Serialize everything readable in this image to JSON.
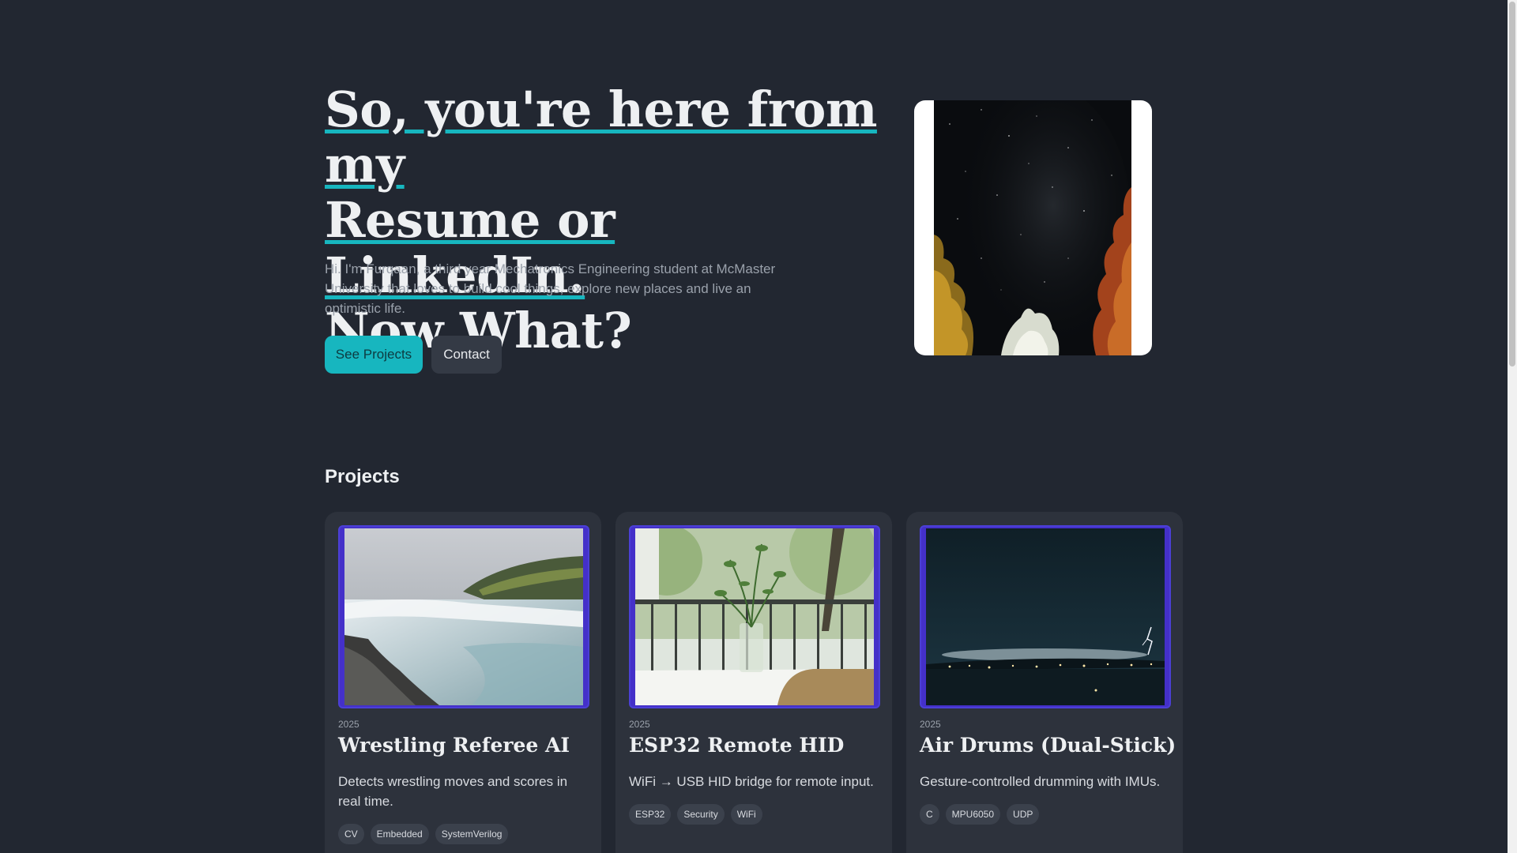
{
  "hero": {
    "heading_line1": "So, you're here from my",
    "heading_line2": "Resume or LinkedIn.",
    "heading_line3": "Now What?",
    "intro": "Hi. I'm Furqaan, a third year Mechatronics Engineering student at McMaster University that loves to build cool things, explore new places and live an optimistic life.",
    "primary_button": "See Projects",
    "secondary_button": "Contact"
  },
  "projects": {
    "section_title": "Projects",
    "items": [
      {
        "year": "2025",
        "title": "Wrestling Referee AI",
        "description": "Detects wrestling moves and scores in real time.",
        "tags": [
          "CV",
          "Embedded",
          "SystemVerilog"
        ]
      },
      {
        "year": "2025",
        "title": "ESP32 Remote HID",
        "description": "WiFi → USB HID bridge for remote input.",
        "tags": [
          "ESP32",
          "Security",
          "WiFi"
        ]
      },
      {
        "year": "2025",
        "title": "Air Drums (Dual-Stick)",
        "description": "Gesture-controlled drumming with IMUs.",
        "tags": [
          "C",
          "MPU6050",
          "UDP"
        ]
      }
    ]
  },
  "colors": {
    "background": "#222731",
    "accent": "#17b6bf",
    "card": "#2d323c",
    "image_border": "#4b3fd6"
  }
}
